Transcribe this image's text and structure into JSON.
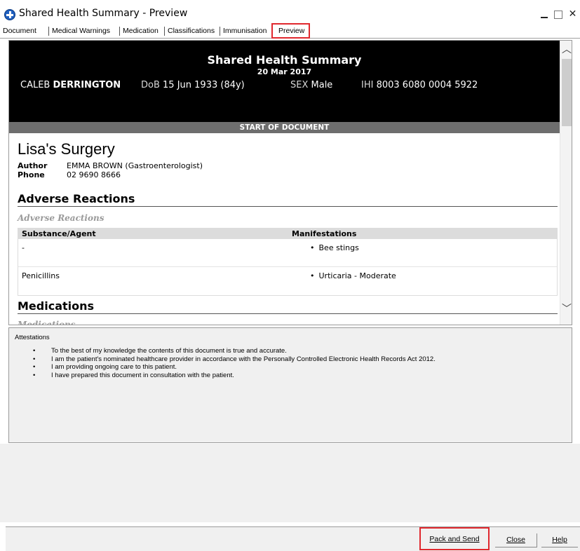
{
  "window": {
    "title": "Shared Health Summary - Preview"
  },
  "tabs": [
    {
      "label": "Document"
    },
    {
      "label": "Medical Warnings"
    },
    {
      "label": "Medication"
    },
    {
      "label": "Classifications"
    },
    {
      "label": "Immunisation"
    },
    {
      "label": "Preview",
      "active": true
    }
  ],
  "document": {
    "title": "Shared Health Summary",
    "date": "20 Mar 2017",
    "patient": {
      "first_name": "CALEB",
      "last_name": "DERRINGTON",
      "dob_label": "DoB",
      "dob": "15 Jun 1933 (84y)",
      "sex_label": "SEX",
      "sex": "Male",
      "ihi_label": "IHI",
      "ihi": "8003 6080 0004 5922"
    },
    "start_banner": "START OF DOCUMENT",
    "organisation": "Lisa's Surgery",
    "author_label": "Author",
    "author": "EMMA BROWN (Gastroenterologist)",
    "phone_label": "Phone",
    "phone": "02 9690 8666",
    "adverse_reactions": {
      "heading": "Adverse Reactions",
      "subheading": "Adverse Reactions",
      "columns": [
        "Substance/Agent",
        "Manifestations"
      ],
      "rows": [
        {
          "substance": "-",
          "manifestation": "Bee stings"
        },
        {
          "substance": "Penicillins",
          "manifestation": "Urticaria - Moderate"
        }
      ]
    },
    "medications": {
      "heading": "Medications",
      "subheading": "Medications"
    }
  },
  "attestations": {
    "title": "Attestations",
    "items": [
      "To the best of my knowledge the contents of this document is true and accurate.",
      "I am the patient's nominated healthcare provider in accordance with the Personally Controlled Electronic Health Records Act 2012.",
      "I am providing ongoing care to this patient.",
      "I have prepared this document in consultation with the patient."
    ]
  },
  "buttons": {
    "pack_send": "Pack and Send",
    "close": "Close",
    "help": "Help"
  },
  "colors": {
    "header_bg": "#000000",
    "banner_bg": "#6e6e6e",
    "highlight": "#e0282e",
    "panel_bg": "#f0f0f0"
  }
}
